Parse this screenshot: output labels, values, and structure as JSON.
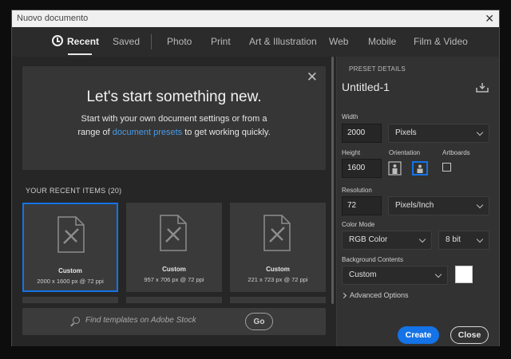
{
  "window": {
    "title": "Nuovo documento",
    "close_glyph": "✕"
  },
  "tabs": [
    {
      "label": "Recent",
      "active": true
    },
    {
      "label": "Saved"
    },
    {
      "label": "Photo"
    },
    {
      "label": "Print"
    },
    {
      "label": "Art & Illustration"
    },
    {
      "label": "Web"
    },
    {
      "label": "Mobile"
    },
    {
      "label": "Film & Video"
    }
  ],
  "hero": {
    "close_glyph": "✕",
    "heading": "Let's start something new.",
    "text_before": "Start with your own document settings or from a range of ",
    "link": "document presets",
    "text_after": " to get working quickly."
  },
  "recent": {
    "title": "YOUR RECENT ITEMS",
    "count": "(20)",
    "items": [
      {
        "name": "Custom",
        "meta": "2000 x 1600 px @ 72 ppi",
        "selected": true
      },
      {
        "name": "Custom",
        "meta": "957 x 706 px @ 72 ppi"
      },
      {
        "name": "Custom",
        "meta": "221 x 723 px @ 72 ppi"
      }
    ]
  },
  "search": {
    "placeholder": "Find templates on Adobe Stock",
    "go_label": "Go"
  },
  "preset": {
    "header": "PRESET DETAILS",
    "name": "Untitled-1",
    "width_label": "Width",
    "width_value": "2000",
    "width_unit": "Pixels",
    "height_label": "Height",
    "height_value": "1600",
    "orientation_label": "Orientation",
    "artboards_label": "Artboards",
    "resolution_label": "Resolution",
    "resolution_value": "72",
    "resolution_unit": "Pixels/Inch",
    "color_mode_label": "Color Mode",
    "color_mode_value": "RGB Color",
    "bit_depth_value": "8 bit",
    "background_label": "Background Contents",
    "background_value": "Custom",
    "background_color": "#ffffff",
    "advanced_label": "Advanced Options"
  },
  "actions": {
    "create": "Create",
    "close": "Close"
  },
  "colors": {
    "accent": "#1473e6",
    "link": "#4a9be8"
  },
  "icons": [
    "clock-icon",
    "close-icon",
    "document-icon",
    "search-icon",
    "save-preset-icon",
    "portrait-icon",
    "landscape-icon",
    "chevron-down-icon",
    "chevron-right-icon"
  ]
}
